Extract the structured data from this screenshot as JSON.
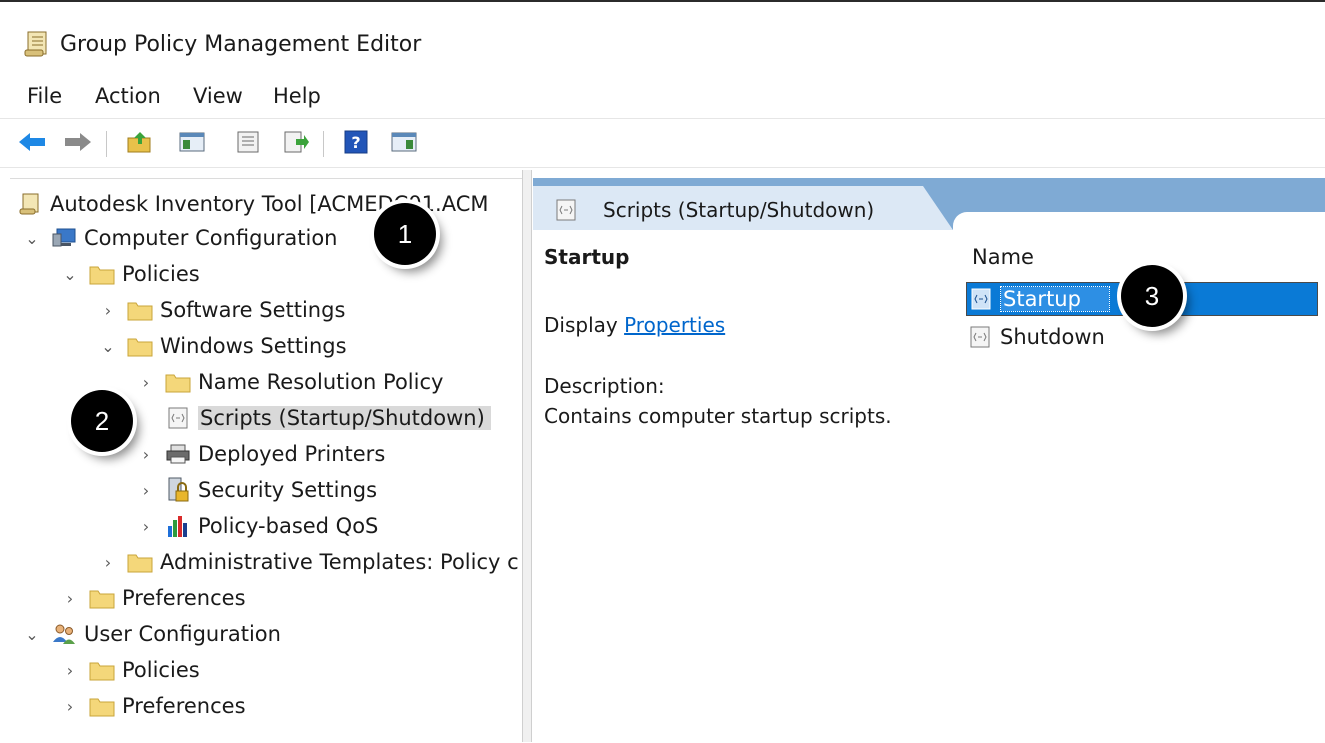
{
  "window": {
    "title": "Group Policy Management Editor"
  },
  "menu": [
    "File",
    "Action",
    "View",
    "Help"
  ],
  "toolbar": {
    "buttons": [
      "back-icon",
      "forward-icon",
      "up-folder-icon",
      "show-hide-console-tree-icon",
      "properties-icon",
      "export-list-icon",
      "help-icon",
      "show-hide-action-pane-icon"
    ]
  },
  "tree": {
    "root": "Autodesk Inventory Tool [ACMEDC01.ACM",
    "computer_configuration": "Computer Configuration",
    "policies": "Policies",
    "software_settings": "Software Settings",
    "windows_settings": "Windows Settings",
    "name_resolution_policy": "Name Resolution Policy",
    "scripts": "Scripts (Startup/Shutdown)",
    "deployed_printers": "Deployed Printers",
    "security_settings": "Security Settings",
    "policy_based_qos": "Policy-based QoS",
    "administrative_templates": "Administrative Templates: Policy c",
    "preferences": "Preferences",
    "user_configuration": "User Configuration",
    "user_policies": "Policies",
    "user_preferences": "Preferences"
  },
  "details": {
    "header_title": "Scripts (Startup/Shutdown)",
    "section_title": "Startup",
    "display_label": "Display",
    "properties_link": "Properties",
    "description_label": "Description:",
    "description_text": "Contains computer startup scripts.",
    "column_name": "Name",
    "items": [
      {
        "label": "Startup",
        "selected": true
      },
      {
        "label": "Shutdown",
        "selected": false
      }
    ]
  },
  "callouts": [
    "1",
    "2",
    "3"
  ],
  "colors": {
    "header_blue": "#7faad4",
    "selection_blue": "#0a7ad6",
    "link": "#0066cc"
  }
}
